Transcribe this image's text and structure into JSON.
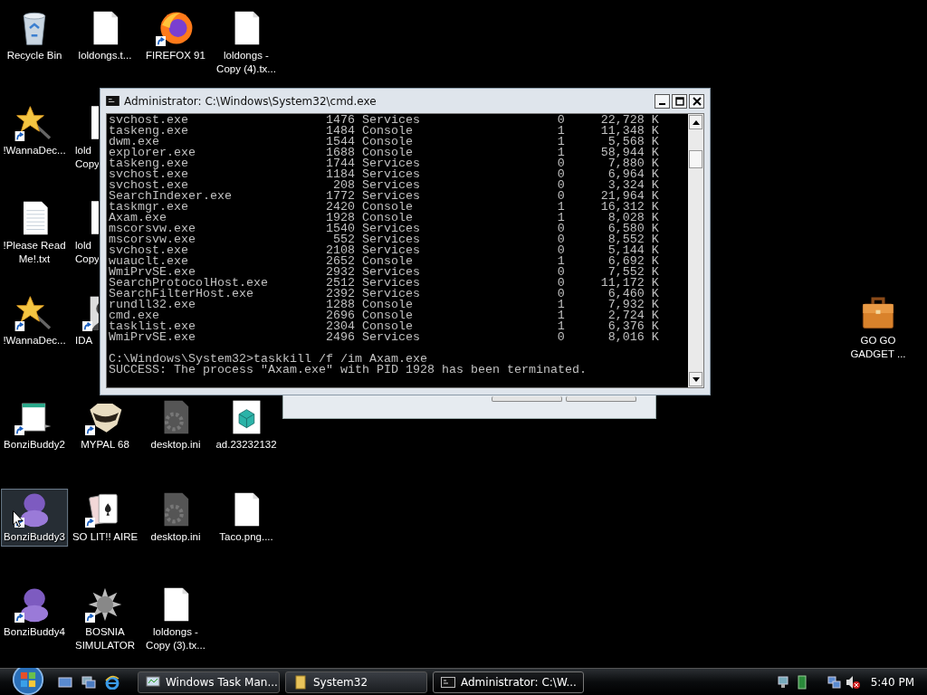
{
  "desktop": {
    "icons": [
      {
        "label": "Recycle Bin",
        "kind": "recycle-bin",
        "shortcut": false,
        "selected": false
      },
      {
        "label": "loldongs.t...",
        "kind": "document",
        "shortcut": false,
        "selected": false
      },
      {
        "label": "FIREFOX 91",
        "kind": "browser",
        "shortcut": true,
        "selected": false
      },
      {
        "label": "loldongs -\nCopy (4).tx...",
        "kind": "document",
        "shortcut": false,
        "selected": false
      },
      {
        "label": "!WannaDec...",
        "kind": "wand",
        "shortcut": true,
        "selected": false
      },
      {
        "label": "lold\nCopy",
        "kind": "document",
        "shortcut": false,
        "selected": false
      },
      {
        "label": "!Please Read\nMe!.txt",
        "kind": "text-file",
        "shortcut": false,
        "selected": false
      },
      {
        "label": "lold\nCopy",
        "kind": "document",
        "shortcut": false,
        "selected": false
      },
      {
        "label": "!WannaDec...",
        "kind": "wand",
        "shortcut": true,
        "selected": false
      },
      {
        "label": "IDA",
        "kind": "portrait",
        "shortcut": true,
        "selected": false
      },
      {
        "label": "GO GO\nGADGET ...",
        "kind": "briefcase",
        "shortcut": false,
        "selected": false
      },
      {
        "label": "BonziBuddy2",
        "kind": "program-window",
        "shortcut": true,
        "selected": false
      },
      {
        "label": "MYPAL 68",
        "kind": "animal",
        "shortcut": true,
        "selected": false
      },
      {
        "label": "desktop.ini",
        "kind": "gear-file",
        "shortcut": false,
        "selected": false
      },
      {
        "label": "ad.23232132",
        "kind": "package",
        "shortcut": false,
        "selected": false
      },
      {
        "label": "BonziBuddy3",
        "kind": "figure",
        "shortcut": true,
        "selected": true
      },
      {
        "label": "SO LIT!! AIRE",
        "kind": "cards",
        "shortcut": true,
        "selected": false
      },
      {
        "label": "desktop.ini",
        "kind": "gear-file",
        "shortcut": false,
        "selected": false
      },
      {
        "label": "Taco.png....",
        "kind": "document",
        "shortcut": false,
        "selected": false
      },
      {
        "label": "BonziBuddy4",
        "kind": "figure",
        "shortcut": true,
        "selected": false
      },
      {
        "label": "BOSNIA\nSIMULATOR",
        "kind": "spiked-ball",
        "shortcut": true,
        "selected": false
      },
      {
        "label": "loldongs -\nCopy (3).tx...",
        "kind": "document",
        "shortcut": false,
        "selected": false
      }
    ]
  },
  "console_window": {
    "title": "Administrator: C:\\Windows\\System32\\cmd.exe",
    "rows": [
      {
        "image": "svchost.exe",
        "pid": "1476",
        "session": "Services",
        "session_number": "0",
        "memory": "22,728 K"
      },
      {
        "image": "taskeng.exe",
        "pid": "1484",
        "session": "Console",
        "session_number": "1",
        "memory": "11,348 K"
      },
      {
        "image": "dwm.exe",
        "pid": "1544",
        "session": "Console",
        "session_number": "1",
        "memory": "5,568 K"
      },
      {
        "image": "explorer.exe",
        "pid": "1688",
        "session": "Console",
        "session_number": "1",
        "memory": "58,944 K"
      },
      {
        "image": "taskeng.exe",
        "pid": "1744",
        "session": "Services",
        "session_number": "0",
        "memory": "7,880 K"
      },
      {
        "image": "svchost.exe",
        "pid": "1184",
        "session": "Services",
        "session_number": "0",
        "memory": "6,964 K"
      },
      {
        "image": "svchost.exe",
        "pid": "208",
        "session": "Services",
        "session_number": "0",
        "memory": "3,324 K"
      },
      {
        "image": "SearchIndexer.exe",
        "pid": "1772",
        "session": "Services",
        "session_number": "0",
        "memory": "21,964 K"
      },
      {
        "image": "taskmgr.exe",
        "pid": "2420",
        "session": "Console",
        "session_number": "1",
        "memory": "16,312 K"
      },
      {
        "image": "Axam.exe",
        "pid": "1928",
        "session": "Console",
        "session_number": "1",
        "memory": "8,028 K"
      },
      {
        "image": "mscorsvw.exe",
        "pid": "1540",
        "session": "Services",
        "session_number": "0",
        "memory": "6,580 K"
      },
      {
        "image": "mscorsvw.exe",
        "pid": "552",
        "session": "Services",
        "session_number": "0",
        "memory": "8,552 K"
      },
      {
        "image": "svchost.exe",
        "pid": "2108",
        "session": "Services",
        "session_number": "0",
        "memory": "5,144 K"
      },
      {
        "image": "wuauclt.exe",
        "pid": "2652",
        "session": "Console",
        "session_number": "1",
        "memory": "6,692 K"
      },
      {
        "image": "WmiPrvSE.exe",
        "pid": "2932",
        "session": "Services",
        "session_number": "0",
        "memory": "7,552 K"
      },
      {
        "image": "SearchProtocolHost.exe",
        "pid": "2512",
        "session": "Services",
        "session_number": "0",
        "memory": "11,172 K"
      },
      {
        "image": "SearchFilterHost.exe",
        "pid": "2392",
        "session": "Services",
        "session_number": "0",
        "memory": "6,460 K"
      },
      {
        "image": "rundll32.exe",
        "pid": "1288",
        "session": "Console",
        "session_number": "1",
        "memory": "7,932 K"
      },
      {
        "image": "cmd.exe",
        "pid": "2696",
        "session": "Console",
        "session_number": "1",
        "memory": "2,724 K"
      },
      {
        "image": "tasklist.exe",
        "pid": "2304",
        "session": "Console",
        "session_number": "1",
        "memory": "6,376 K"
      },
      {
        "image": "WmiPrvSE.exe",
        "pid": "2496",
        "session": "Services",
        "session_number": "0",
        "memory": "8,016 K"
      }
    ],
    "command": "C:\\Windows\\System32>taskkill /f /im Axam.exe",
    "output": "SUCCESS: The process \"Axam.exe\" with PID 1928 has been terminated."
  },
  "taskbar": {
    "tasks": [
      {
        "label": "Windows Task Man...",
        "kind": "task-manager",
        "selected": false
      },
      {
        "label": "System32",
        "kind": "folder",
        "selected": false
      },
      {
        "label": "Administrator: C:\\W...",
        "kind": "console",
        "selected": true
      }
    ],
    "clock": "5:40 PM"
  }
}
